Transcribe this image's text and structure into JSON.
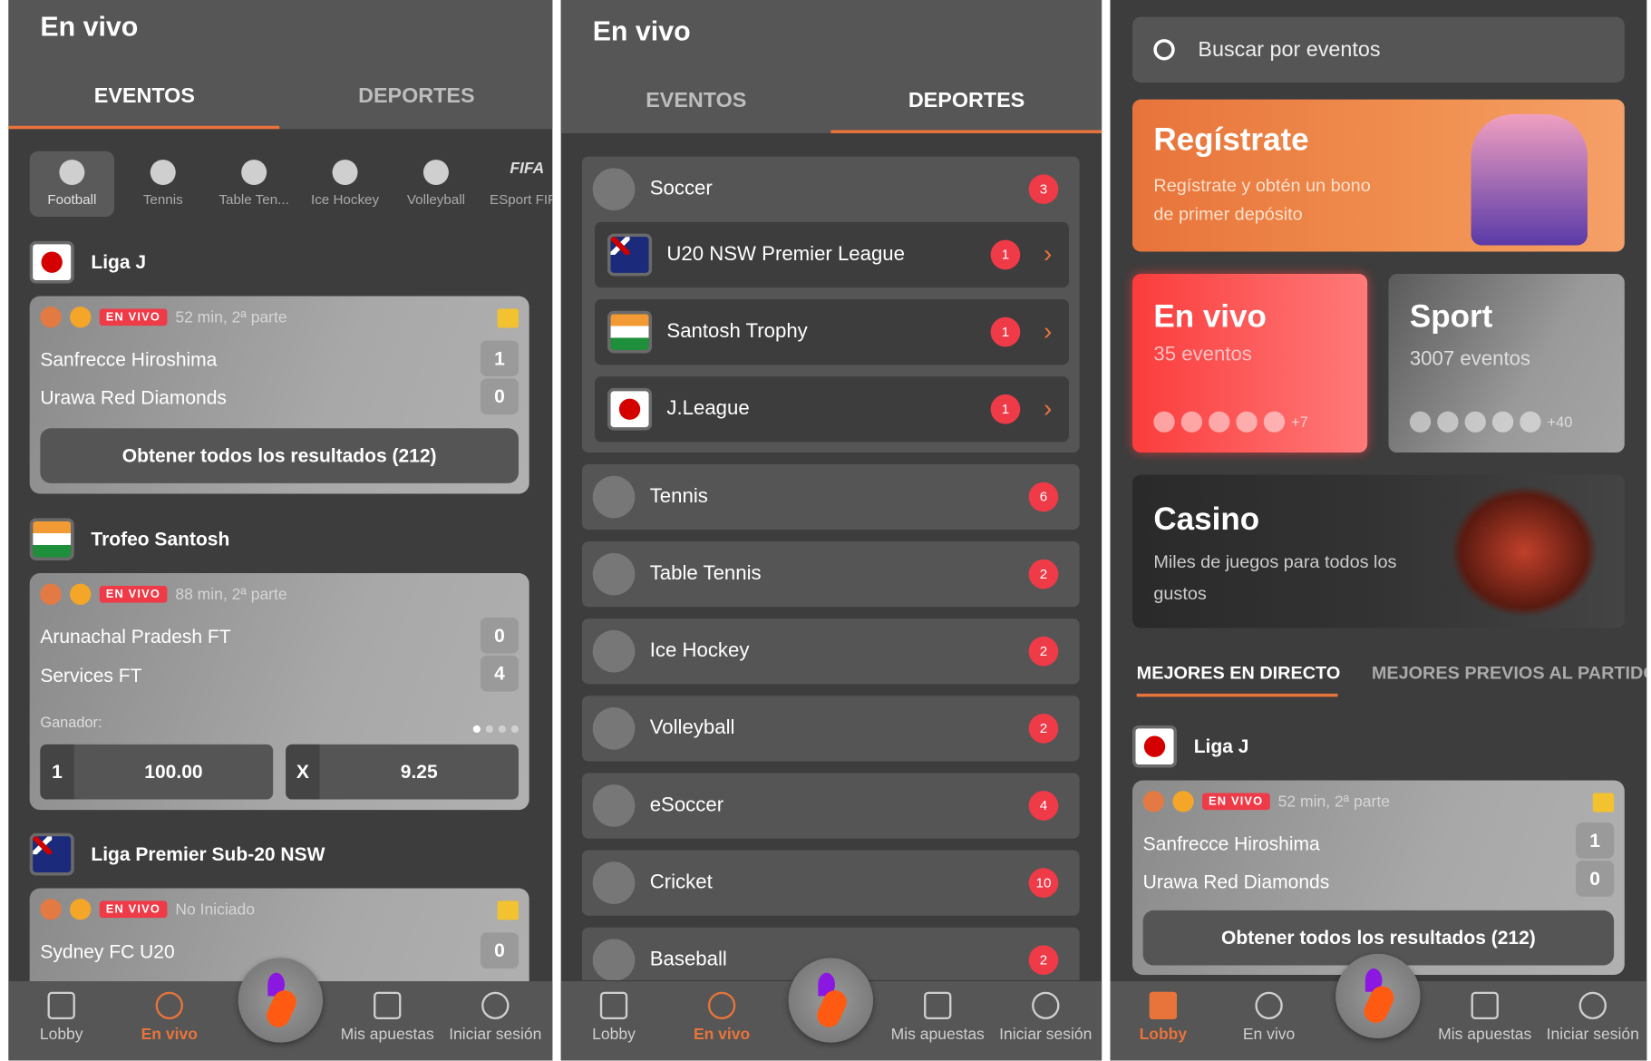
{
  "colors": {
    "accent": "#e8743b",
    "live": "#ef3a47",
    "background": "#3d3d3d"
  },
  "panel1": {
    "title": "En vivo",
    "tabs": [
      "EVENTOS",
      "DEPORTES"
    ],
    "sports": [
      "Football",
      "Tennis",
      "Table Ten...",
      "Ice Hockey",
      "Volleyball",
      "ESport FIFA"
    ],
    "fifa_label": "FIFA",
    "leagues": [
      {
        "name": "Liga J",
        "flag": "japan",
        "badge": "EN VIVO",
        "time": "52 min, 2ª parte",
        "teams": [
          {
            "name": "Sanfrecce Hiroshima",
            "score": "1"
          },
          {
            "name": "Urawa Red Diamonds",
            "score": "0"
          }
        ],
        "button": "Obtener todos los resultados (212)"
      },
      {
        "name": "Trofeo Santosh",
        "flag": "india",
        "badge": "EN VIVO",
        "time": "88 min, 2ª parte",
        "teams": [
          {
            "name": "Arunachal Pradesh FT",
            "score": "0"
          },
          {
            "name": "Services FT",
            "score": "4"
          }
        ],
        "winner_label": "Ganador:",
        "odds": [
          {
            "key": "1",
            "value": "100.00"
          },
          {
            "key": "X",
            "value": "9.25"
          }
        ]
      },
      {
        "name": "Liga Premier Sub-20 NSW",
        "flag": "australia",
        "badge": "EN VIVO",
        "time": "No Iniciado",
        "teams": [
          {
            "name": "Sydney FC U20",
            "score": "0"
          }
        ]
      }
    ]
  },
  "panel2": {
    "title": "En vivo",
    "tabs": [
      "EVENTOS",
      "DEPORTES"
    ],
    "soccer": {
      "name": "Soccer",
      "count": "3",
      "leagues": [
        {
          "name": "U20 NSW Premier League",
          "count": "1",
          "flag": "australia"
        },
        {
          "name": "Santosh Trophy",
          "count": "1",
          "flag": "india"
        },
        {
          "name": "J.League",
          "count": "1",
          "flag": "japan"
        }
      ]
    },
    "sports": [
      {
        "name": "Tennis",
        "count": "6"
      },
      {
        "name": "Table Tennis",
        "count": "2"
      },
      {
        "name": "Ice Hockey",
        "count": "2"
      },
      {
        "name": "Volleyball",
        "count": "2"
      },
      {
        "name": "eSoccer",
        "count": "4"
      },
      {
        "name": "Cricket",
        "count": "10"
      },
      {
        "name": "Baseball",
        "count": "2"
      }
    ]
  },
  "panel3": {
    "search_placeholder": "Buscar por eventos",
    "promo": {
      "title": "Regístrate",
      "text": "Regístrate y obtén un bono de primer depósito"
    },
    "live_card": {
      "title": "En vivo",
      "count": "35 eventos",
      "more": "+7"
    },
    "sport_card": {
      "title": "Sport",
      "count": "3007 eventos",
      "more": "+40"
    },
    "casino": {
      "title": "Casino",
      "text": "Miles de juegos para todos los gustos"
    },
    "tabs": [
      "MEJORES EN DIRECTO",
      "MEJORES PREVIOS AL PARTIDO"
    ],
    "league": {
      "name": "Liga J",
      "badge": "EN VIVO",
      "time": "52 min, 2ª parte",
      "teams": [
        {
          "name": "Sanfrecce Hiroshima",
          "score": "1"
        },
        {
          "name": "Urawa Red Diamonds",
          "score": "0"
        }
      ],
      "button": "Obtener todos los resultados (212)"
    }
  },
  "nav": [
    "Lobby",
    "En vivo",
    "Mis apuestas",
    "Iniciar sesión"
  ]
}
